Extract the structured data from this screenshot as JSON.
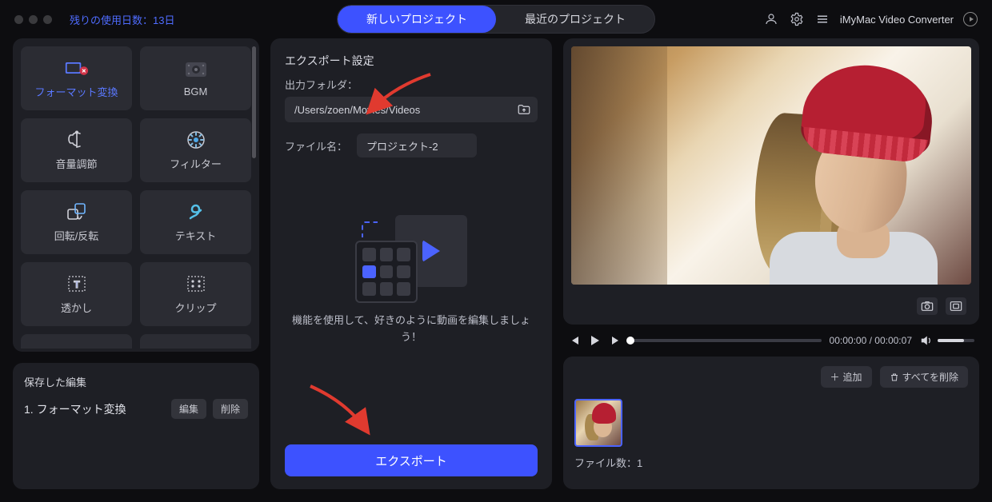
{
  "topbar": {
    "trial_label": "残りの使用日数：13日",
    "tabs": {
      "new_project": "新しいプロジェクト",
      "recent_projects": "最近のプロジェクト"
    },
    "app_name": "iMyMac Video Converter"
  },
  "tools": {
    "format": "フォーマット変換",
    "bgm": "BGM",
    "volume": "音量調節",
    "filter": "フィルター",
    "rotate": "回転/反転",
    "text": "テキスト",
    "watermark": "透かし",
    "clip": "クリップ"
  },
  "saved": {
    "title": "保存した編集",
    "row1_text": "1.  フォーマット変換",
    "edit": "編集",
    "delete": "削除"
  },
  "export": {
    "section_title": "エクスポート設定",
    "folder_label": "出力フォルダ：",
    "folder_path": "/Users/zoen/Movies/Videos",
    "filename_label": "ファイル名：",
    "filename_value": "プロジェクト-2",
    "hint": "機能を使用して、好きのように動画を編集しましょう！",
    "button": "エクスポート"
  },
  "player": {
    "time_current": "00:00:00",
    "time_total": "00:00:07"
  },
  "files": {
    "add": "追加",
    "delete_all": "すべてを削除",
    "count_label": "ファイル数：1"
  }
}
